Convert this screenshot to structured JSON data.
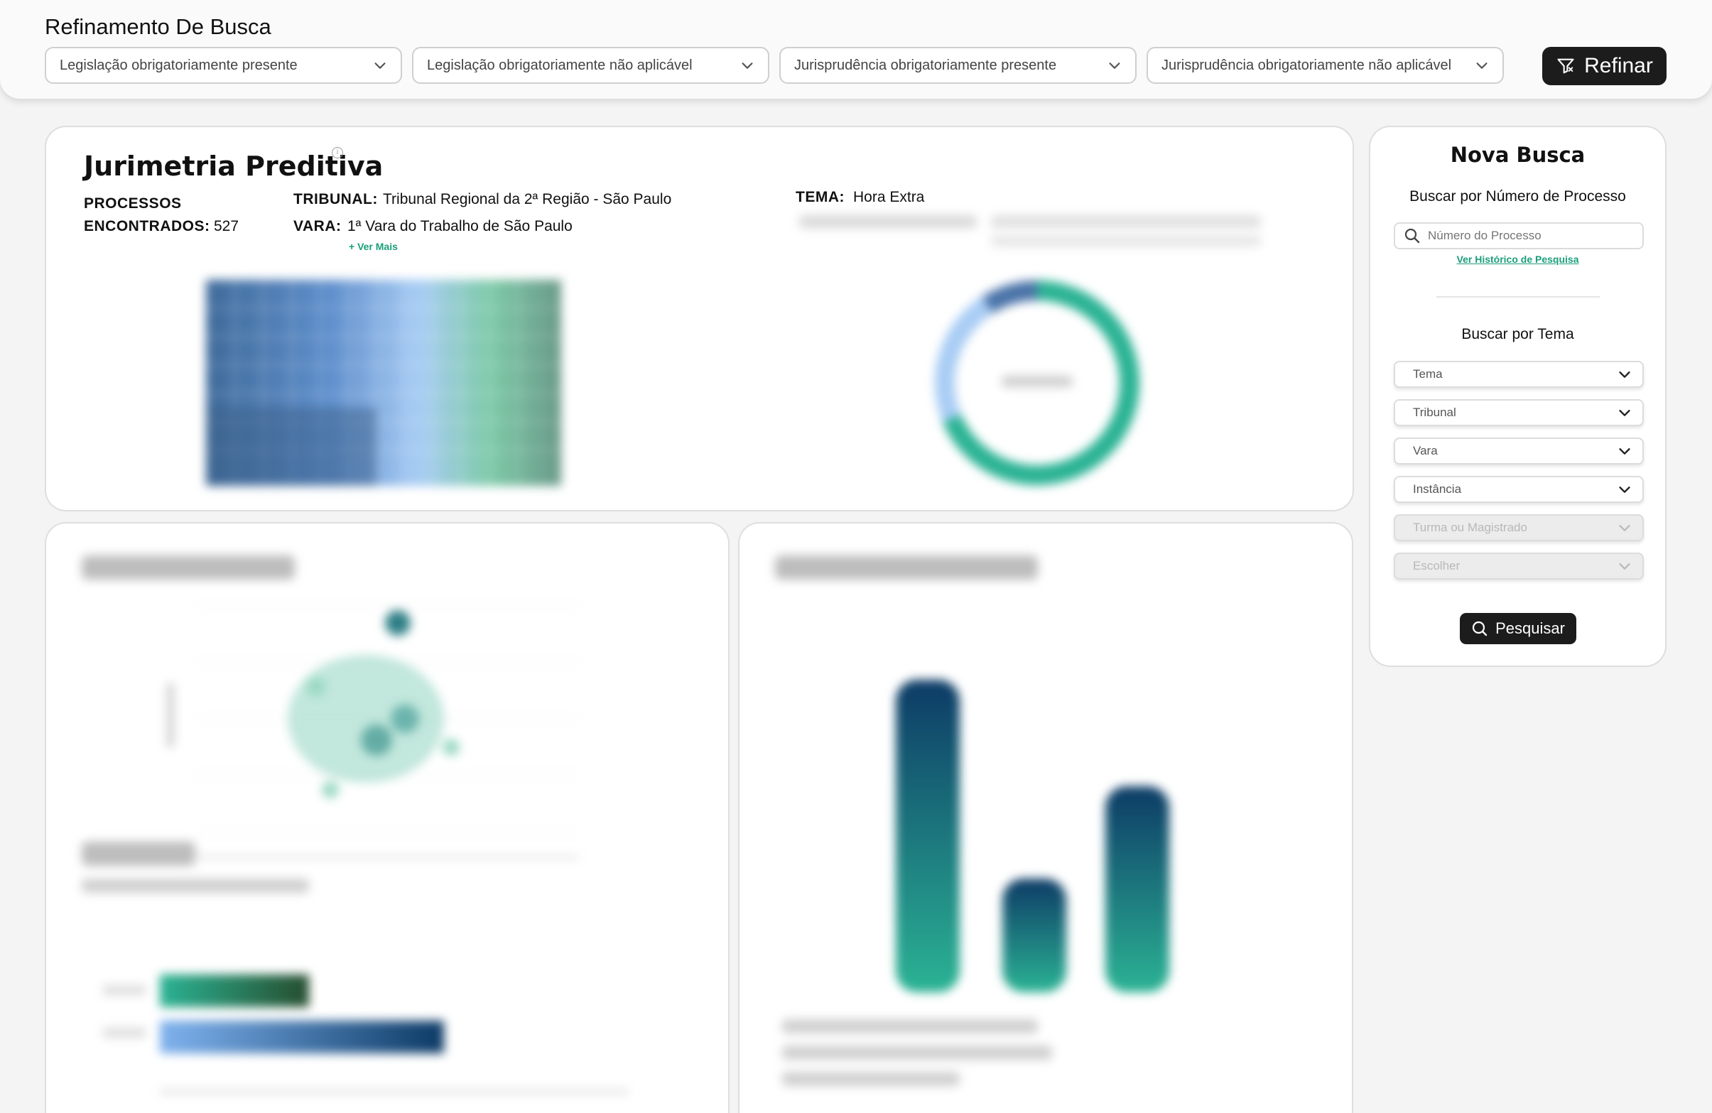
{
  "refinement": {
    "title": "Refinamento De Busca",
    "filters": [
      {
        "label": "Legislação obrigatoriamente presente"
      },
      {
        "label": "Legislação obrigatoriamente não aplicável"
      },
      {
        "label": "Jurisprudência obrigatoriamente presente"
      },
      {
        "label": "Jurisprudência obrigatoriamente não aplicável"
      }
    ],
    "refine_button": "Refinar"
  },
  "jurimetria": {
    "title": "Jurimetria Preditiva",
    "processos_label_1": "PROCESSOS",
    "processos_label_2": "ENCONTRADOS:",
    "processos_value": "527",
    "tribunal_label": "TRIBUNAL:",
    "tribunal_value": "Tribunal Regional da 2ª Região - São Paulo",
    "vara_label": "VARA:",
    "vara_value": "1ª Vara do Trabalho de São Paulo",
    "ver_mais": "+ Ver Mais",
    "tema_label": "TEMA:",
    "tema_value": "Hora Extra"
  },
  "nova_busca": {
    "title": "Nova Busca",
    "by_number_label": "Buscar por Número de Processo",
    "number_placeholder": "Número do Processo",
    "history_link": "Ver Histórico de Pesquisa",
    "by_theme_label": "Buscar por Tema",
    "selects": [
      {
        "label": "Tema",
        "disabled": false
      },
      {
        "label": "Tribunal",
        "disabled": false
      },
      {
        "label": "Vara",
        "disabled": false
      },
      {
        "label": "Instância",
        "disabled": false
      },
      {
        "label": "Turma ou Magistrado",
        "disabled": true
      },
      {
        "label": "Escolher",
        "disabled": true
      }
    ],
    "search_button": "Pesquisar"
  },
  "colors": {
    "accent_green": "#1a9e7a",
    "dark_navy": "#0d3b66",
    "teal": "#2bb394",
    "light_blue": "#7fb2ee",
    "button_dark": "#1c1c1c"
  }
}
